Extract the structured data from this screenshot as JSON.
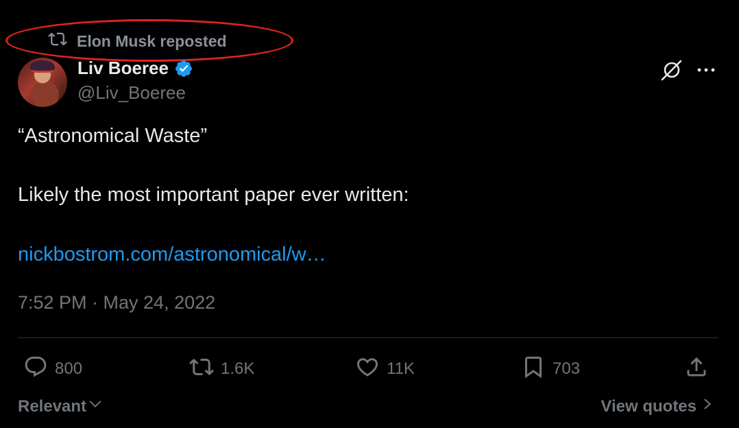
{
  "repost": {
    "text": "Elon Musk reposted",
    "icon": "repost-icon"
  },
  "author": {
    "name": "Liv Boeree",
    "handle": "@Liv_Boeree",
    "verified": true,
    "verified_color": "#1d9bf0"
  },
  "tweet": {
    "title_line": "“Astronomical Waste”",
    "body_line": "Likely the most important paper ever written:",
    "link_text": "nickbostrom.com/astronomical/w…",
    "timestamp": "7:52 PM · May 24, 2022"
  },
  "actions": {
    "replies": "800",
    "reposts": "1.6K",
    "likes": "11K",
    "bookmarks": "703"
  },
  "footer": {
    "sort_label": "Relevant",
    "view_quotes_label": "View quotes"
  },
  "colors": {
    "background": "#000000",
    "text_primary": "#e7e9ea",
    "text_secondary": "#71767b",
    "link": "#1d9bf0",
    "annotation": "#e0241f"
  }
}
